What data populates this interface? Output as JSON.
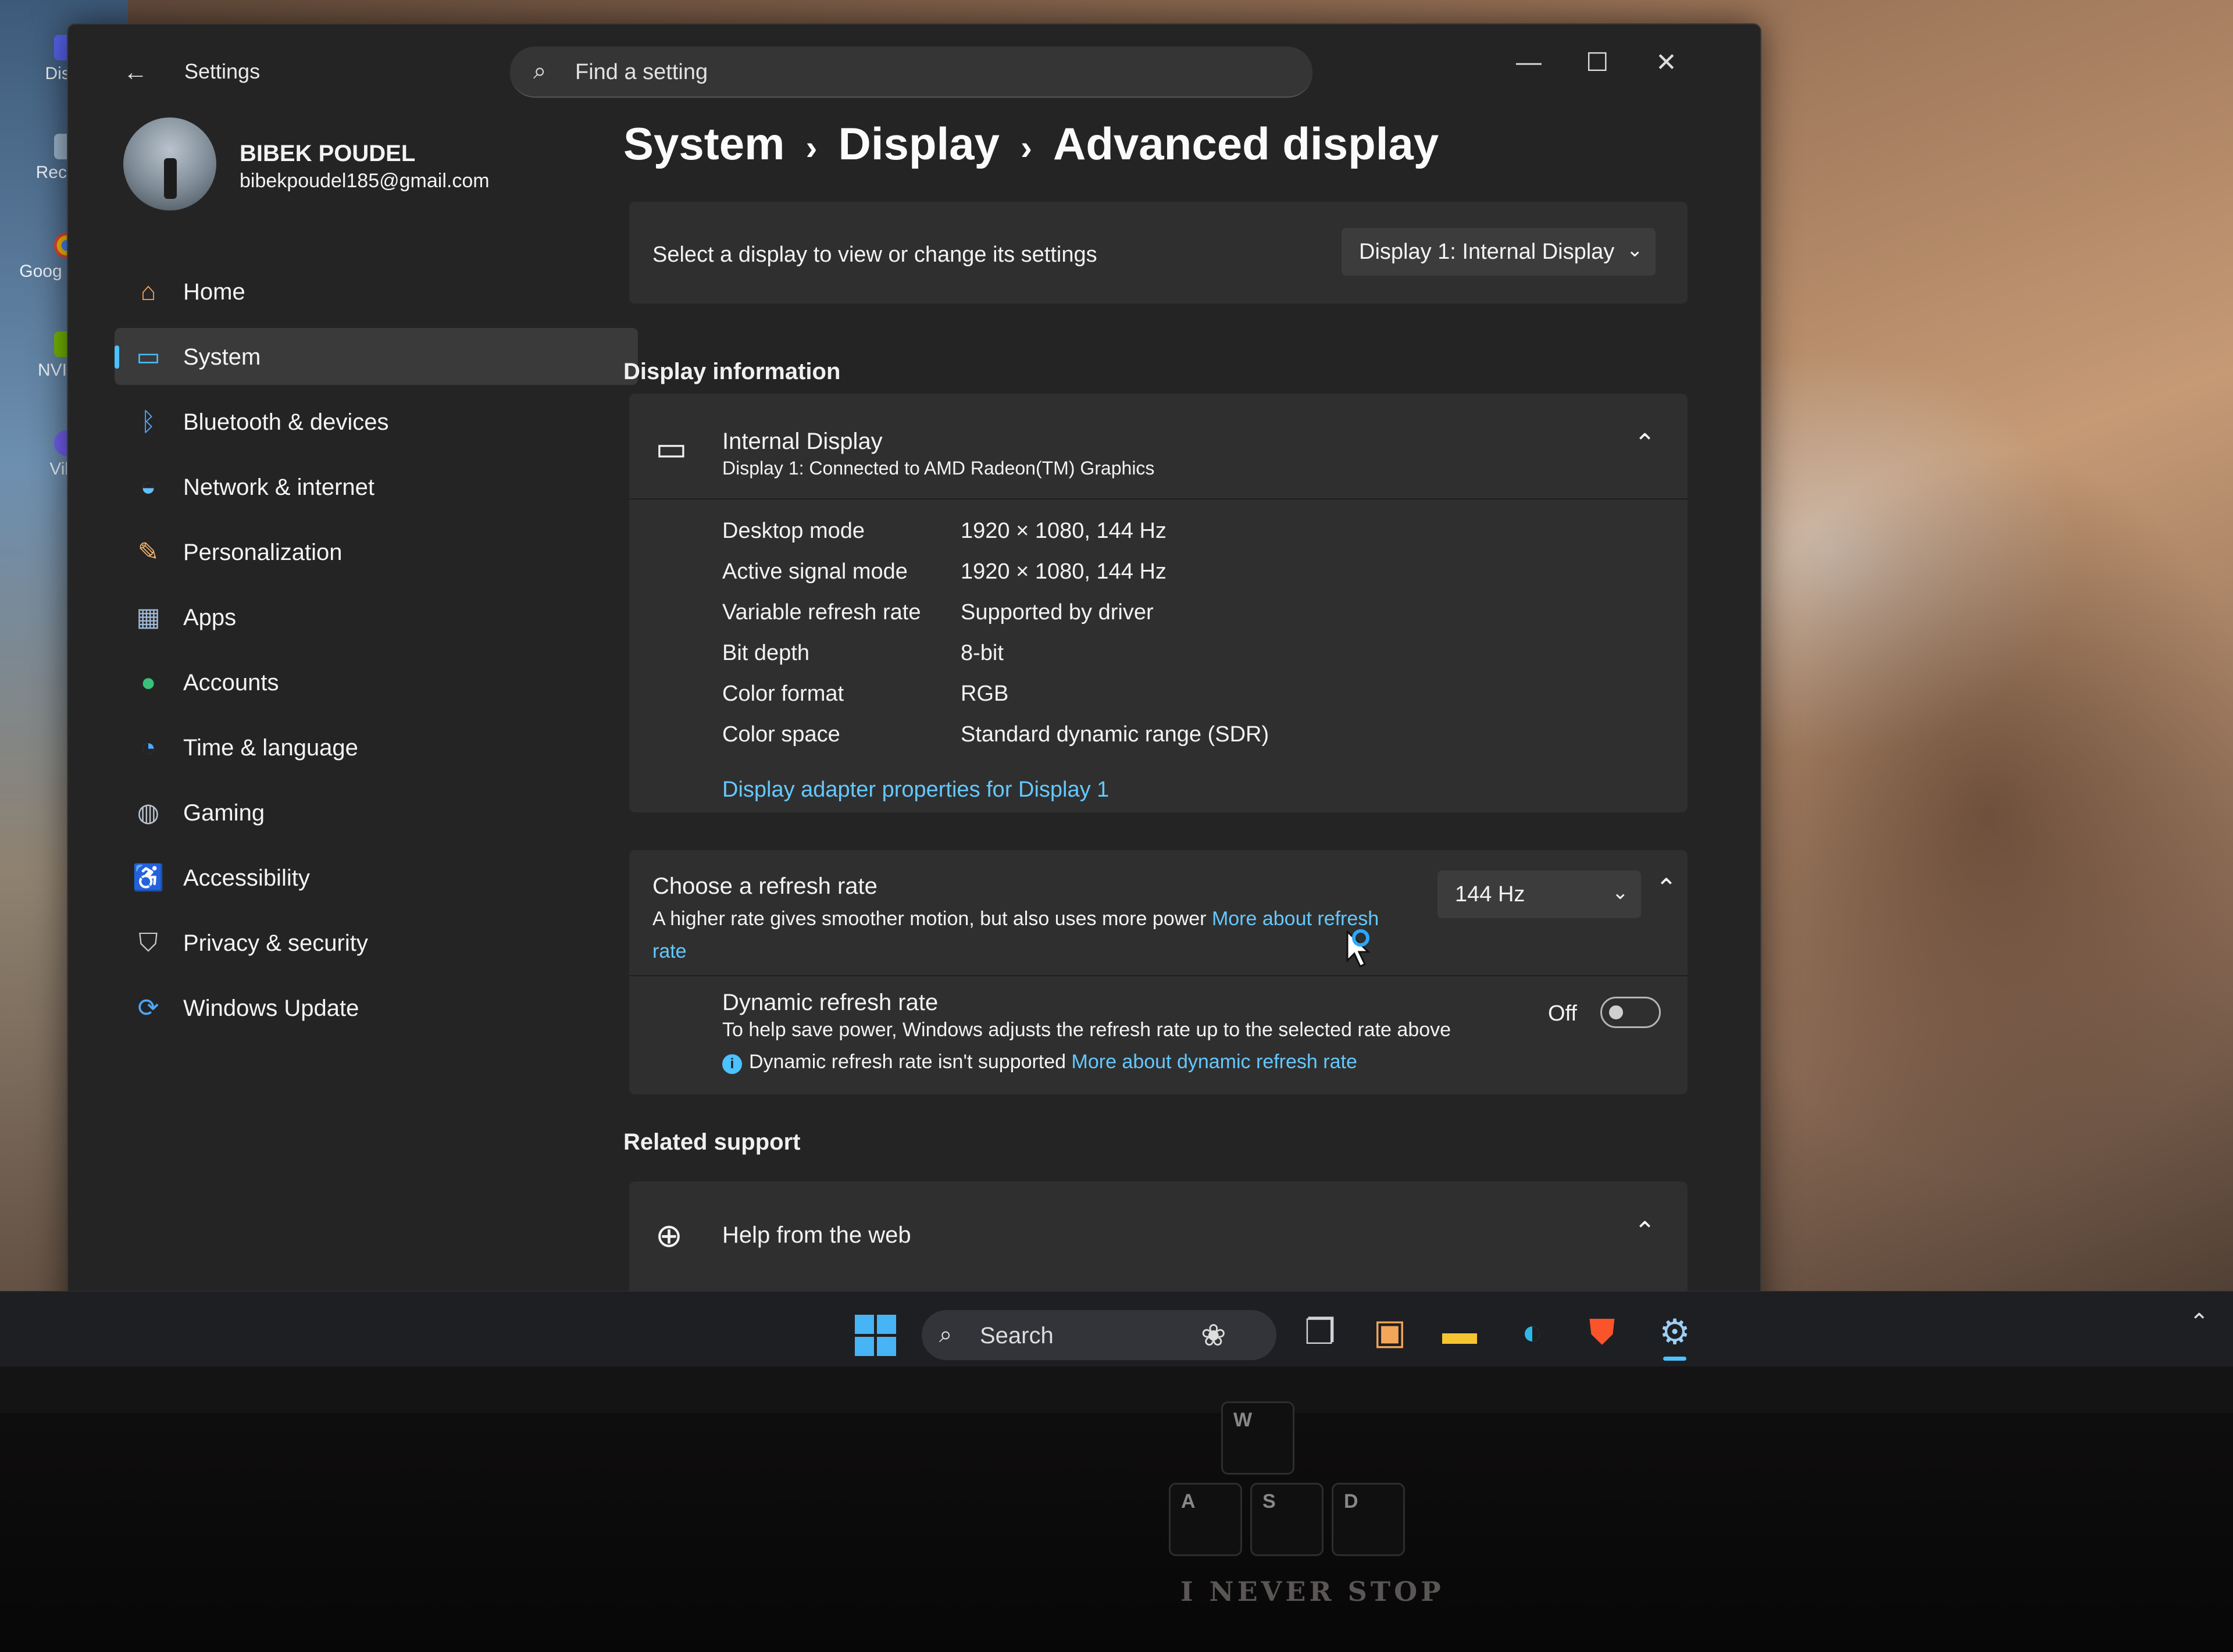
{
  "desktop": {
    "icons": [
      {
        "label": "Disco",
        "name": "discord"
      },
      {
        "label": "Recycle",
        "name": "recycle-bin"
      },
      {
        "label": "Goog Chron",
        "name": "google-chrome"
      },
      {
        "label": "NVIDIA",
        "name": "nvidia"
      },
      {
        "label": "Vibe",
        "name": "viber"
      }
    ]
  },
  "window": {
    "title": "Settings",
    "search_placeholder": "Find a setting",
    "controls": {
      "minimize": "—",
      "maximize": "☐",
      "close": "✕"
    }
  },
  "profile": {
    "name": "BIBEK POUDEL",
    "email": "bibekpoudel185@gmail.com"
  },
  "nav": [
    {
      "label": "Home",
      "icon": "home-icon",
      "glyph": "⌂",
      "color": "#f0a25a",
      "active": false
    },
    {
      "label": "System",
      "icon": "system-icon",
      "glyph": "▭",
      "color": "#4cc2ff",
      "active": true
    },
    {
      "label": "Bluetooth & devices",
      "icon": "bluetooth-icon",
      "glyph": "ᛒ",
      "color": "#4aa8ff",
      "active": false
    },
    {
      "label": "Network & internet",
      "icon": "network-icon",
      "glyph": "◒",
      "color": "#61c0ff",
      "active": false
    },
    {
      "label": "Personalization",
      "icon": "brush-icon",
      "glyph": "✎",
      "color": "#f4b36b",
      "active": false
    },
    {
      "label": "Apps",
      "icon": "apps-icon",
      "glyph": "▦",
      "color": "#9fb8d6",
      "active": false
    },
    {
      "label": "Accounts",
      "icon": "accounts-icon",
      "glyph": "●",
      "color": "#39c07a",
      "active": false
    },
    {
      "label": "Time & language",
      "icon": "globe-clock-icon",
      "glyph": "◔",
      "color": "#4aa8ff",
      "active": false
    },
    {
      "label": "Gaming",
      "icon": "gamepad-icon",
      "glyph": "◍",
      "color": "#b8c2cc",
      "active": false
    },
    {
      "label": "Accessibility",
      "icon": "accessibility-icon",
      "glyph": "♿",
      "color": "#4aa8ff",
      "active": false
    },
    {
      "label": "Privacy & security",
      "icon": "shield-icon",
      "glyph": "⛉",
      "color": "#c9ced4",
      "active": false
    },
    {
      "label": "Windows Update",
      "icon": "update-icon",
      "glyph": "⟳",
      "color": "#4aa8ff",
      "active": false
    }
  ],
  "breadcrumb": {
    "items": [
      "System",
      "Display",
      "Advanced display"
    ],
    "separator": "›"
  },
  "display_select": {
    "label": "Select a display to view or change its settings",
    "value": "Display 1: Internal Display"
  },
  "display_information": {
    "heading": "Display information",
    "title": "Internal Display",
    "subtitle": "Display 1: Connected to AMD Radeon(TM) Graphics",
    "rows": [
      {
        "key": "Desktop mode",
        "value": "1920 × 1080, 144 Hz"
      },
      {
        "key": "Active signal mode",
        "value": "1920 × 1080, 144 Hz"
      },
      {
        "key": "Variable refresh rate",
        "value": "Supported by driver"
      },
      {
        "key": "Bit depth",
        "value": "8-bit"
      },
      {
        "key": "Color format",
        "value": "RGB"
      },
      {
        "key": "Color space",
        "value": "Standard dynamic range (SDR)"
      }
    ],
    "adapter_link": "Display adapter properties for Display 1"
  },
  "refresh_rate": {
    "title": "Choose a refresh rate",
    "description": "A higher rate gives smoother motion, but also uses more power",
    "link": "More about refresh rate",
    "value": "144 Hz",
    "dynamic": {
      "title": "Dynamic refresh rate",
      "description": "To help save power, Windows adjusts the refresh rate up to the selected rate above",
      "note": "Dynamic refresh rate isn't supported",
      "note_link": "More about dynamic refresh rate",
      "state": "Off"
    }
  },
  "related_support": {
    "heading": "Related support",
    "help_label": "Help from the web"
  },
  "taskbar": {
    "search_label": "Search",
    "apps": [
      {
        "name": "task-view-icon",
        "glyph": "❐"
      },
      {
        "name": "store-icon",
        "glyph": "▣"
      },
      {
        "name": "file-explorer-icon",
        "glyph": "▬"
      },
      {
        "name": "edge-icon",
        "glyph": "◐"
      },
      {
        "name": "brave-icon",
        "glyph": "⛊"
      },
      {
        "name": "settings-gear-icon",
        "glyph": "⚙"
      }
    ]
  },
  "keyboard": {
    "keys": [
      "W",
      "A",
      "S",
      "D"
    ],
    "slogan": "I NEVER STOP"
  },
  "colors": {
    "accent": "#4cc2ff",
    "link": "#63c9ff",
    "window_bg": "#252424",
    "card_bg": "#302f2f"
  }
}
